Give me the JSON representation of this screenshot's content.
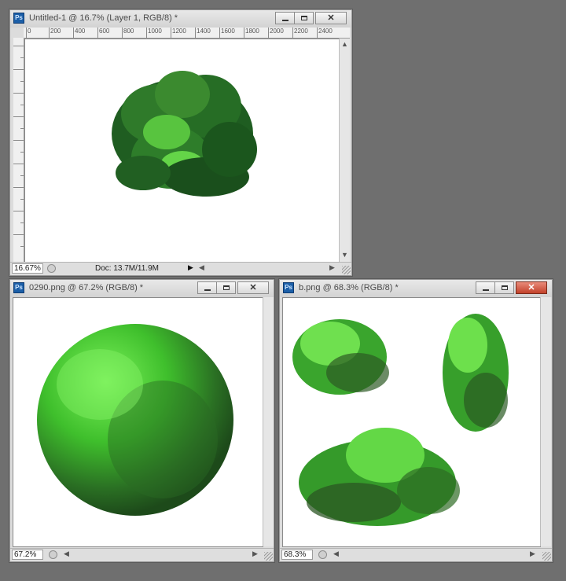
{
  "windows": [
    {
      "title": "Untitled-1 @ 16.7% (Layer 1, RGB/8) *",
      "zoom": "16.67%",
      "doc_info": "Doc: 13.7M/11.9M",
      "ruler_ticks": [
        "0",
        "200",
        "400",
        "600",
        "800",
        "1000",
        "1200",
        "1400",
        "1600",
        "1800",
        "2000",
        "2200",
        "2400"
      ]
    },
    {
      "title": "0290.png @ 67.2% (RGB/8) *",
      "zoom": "67.2%"
    },
    {
      "title": "b.png @ 68.3% (RGB/8) *",
      "zoom": "68.3%"
    }
  ],
  "icons": {
    "app": "photoshop-icon",
    "minimize": "minimize-icon",
    "maximize": "maximize-icon",
    "close": "close-icon"
  },
  "colors": {
    "workspace": "#6f6f6f",
    "close_active": "#c2412a",
    "foliage_dark": "#1e5a1e",
    "foliage_light": "#5fe04a"
  }
}
